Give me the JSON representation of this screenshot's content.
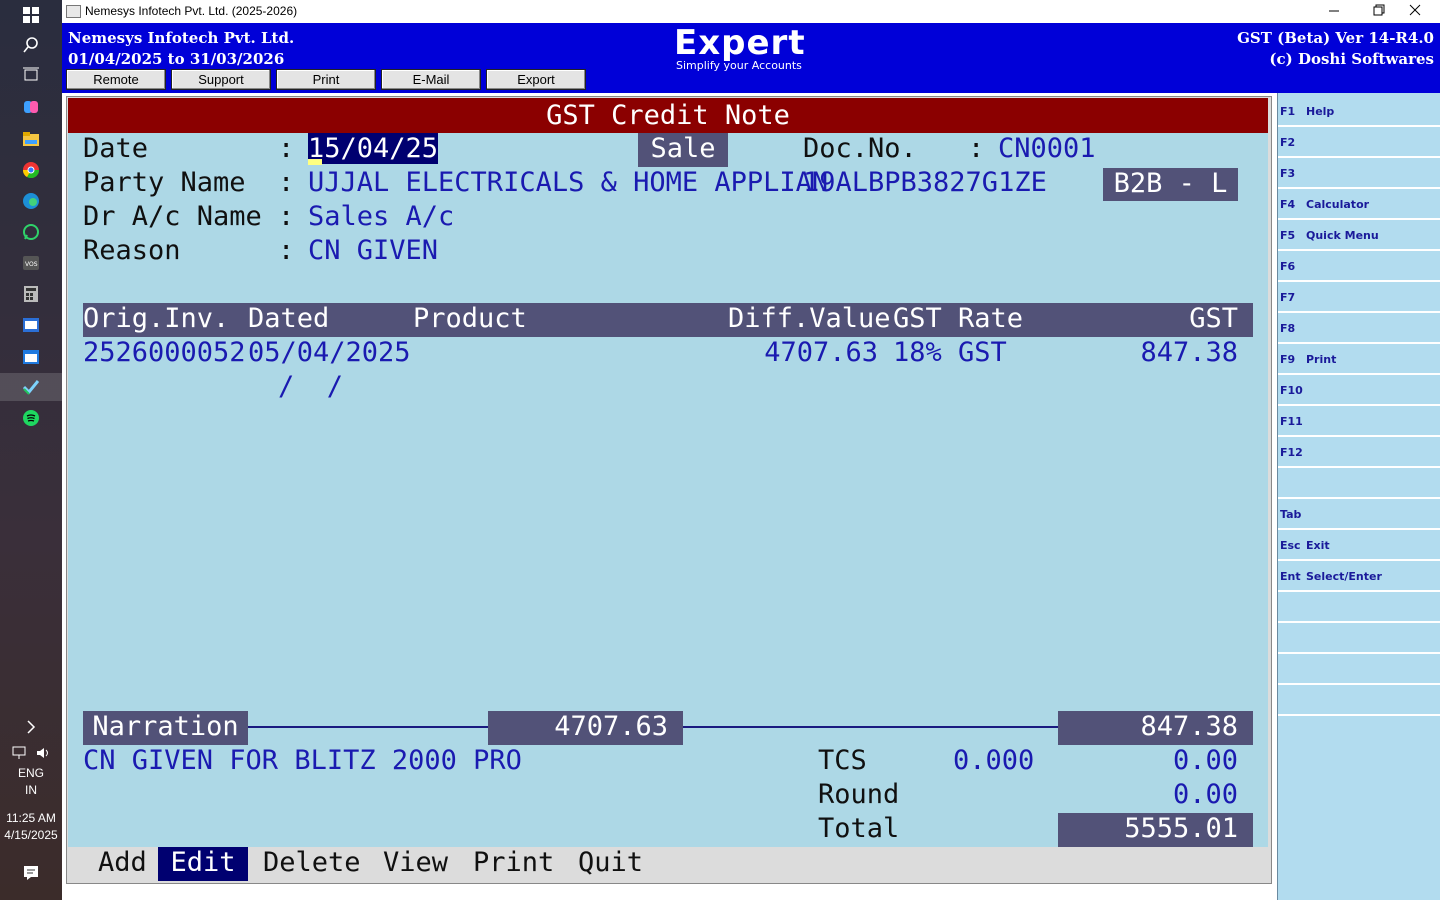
{
  "window": {
    "title": "Nemesys Infotech Pvt. Ltd. (2025-2026)"
  },
  "header": {
    "company": "Nemesys Infotech Pvt. Ltd.",
    "period": "01/04/2025 to 31/03/2026",
    "logo": "Expert",
    "tagline": "Simplify your Accounts",
    "version": "GST (Beta) Ver 14-R4.0",
    "copyright": "(c) Doshi Softwares",
    "buttons": [
      "Remote",
      "Support",
      "Print",
      "E-Mail",
      "Export"
    ]
  },
  "form": {
    "title": "GST Credit Note",
    "date_label": "Date",
    "date_value": "15/04/25",
    "type_badge": "Sale",
    "docno_label": "Doc.No.",
    "docno_value": "CN0001",
    "party_label": "Party Name",
    "party_value": "UJJAL ELECTRICALS & HOME APPLIAN",
    "gstin": "19ALBPB3827G1ZE",
    "category_badge": "B2B - L",
    "dr_label": "Dr A/c Name",
    "dr_value": "Sales A/c",
    "reason_label": "Reason",
    "reason_value": "CN GIVEN",
    "colon": ":"
  },
  "table": {
    "headers": {
      "orig_inv": "Orig.Inv.",
      "dated": "Dated",
      "product": "Product",
      "diff_value": "Diff.Value",
      "gst_rate": "GST Rate",
      "gst": "GST"
    },
    "rows": [
      {
        "orig_inv": "2526000052",
        "dated": "05/04/2025",
        "product": "",
        "diff_value": "4707.63",
        "gst_rate": "18% GST",
        "gst": "847.38"
      }
    ],
    "blank_row_date": "/  /"
  },
  "totals": {
    "narration_label": "Narration",
    "diff_total": "4707.63",
    "gst_total": "847.38",
    "narration_text": "CN GIVEN FOR BLITZ 2000 PRO",
    "tcs_label": "TCS",
    "tcs_rate": "0.000",
    "tcs_amount": "0.00",
    "round_label": "Round",
    "round_amount": "0.00",
    "total_label": "Total",
    "total_amount": "5555.01"
  },
  "menu": [
    "Add",
    "Edit",
    "Delete",
    "View",
    "Print",
    "Quit"
  ],
  "menu_selected": "Edit",
  "fkeys": [
    {
      "key": "F1",
      "label": "Help"
    },
    {
      "key": "F2",
      "label": ""
    },
    {
      "key": "F3",
      "label": ""
    },
    {
      "key": "F4",
      "label": "Calculator"
    },
    {
      "key": "F5",
      "label": "Quick Menu"
    },
    {
      "key": "F6",
      "label": ""
    },
    {
      "key": "F7",
      "label": ""
    },
    {
      "key": "F8",
      "label": ""
    },
    {
      "key": "F9",
      "label": "Print"
    },
    {
      "key": "F10",
      "label": ""
    },
    {
      "key": "F11",
      "label": ""
    },
    {
      "key": "F12",
      "label": ""
    },
    {
      "key": "",
      "label": ""
    },
    {
      "key": "Tab",
      "label": ""
    },
    {
      "key": "Esc",
      "label": "Exit"
    },
    {
      "key": "Ent",
      "label": "Select/Enter"
    }
  ],
  "taskbar": {
    "language": "ENG",
    "region": "IN",
    "time": "11:25 AM",
    "date": "4/15/2025",
    "icons": [
      "windows-start-icon",
      "search-icon",
      "task-view-icon",
      "copilot-icon",
      "file-explorer-icon",
      "chrome-icon",
      "edge-icon",
      "whatsapp-icon",
      "vos-icon",
      "calculator-icon",
      "news-icon",
      "calendar-icon",
      "tasks-icon",
      "spotify-icon"
    ]
  },
  "colors": {
    "header_bg": "#0000d8",
    "title_bar": "#8b0000",
    "panel_bg": "#add8e6",
    "band": "#525278",
    "text_blue": "#1a1ab0"
  }
}
